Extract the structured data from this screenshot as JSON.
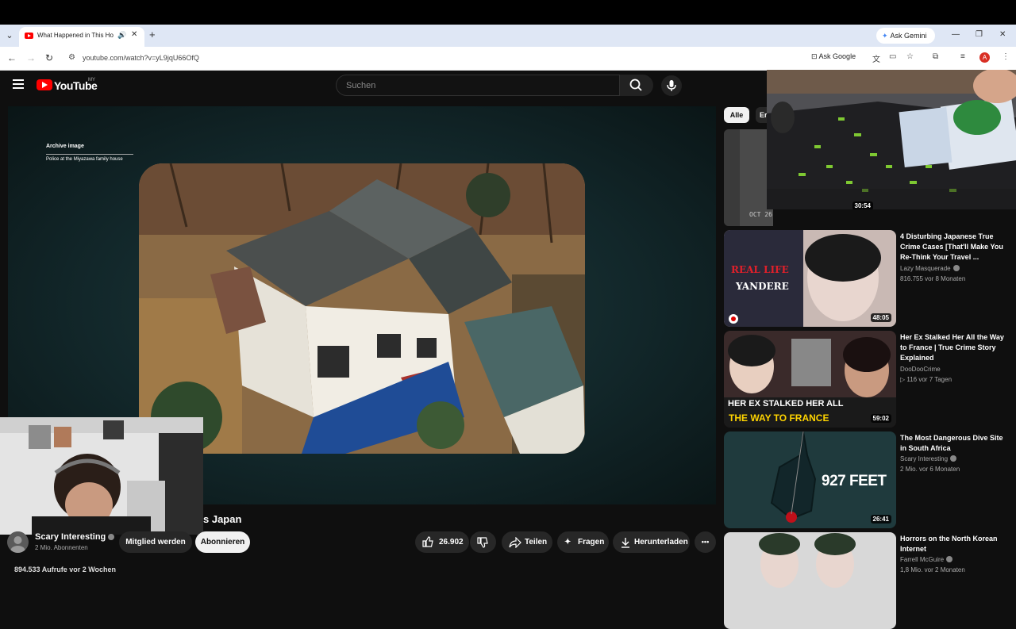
{
  "browser": {
    "tab_title": "What Happened in This Ho",
    "new_tab_label": "+",
    "gemini_label": "Ask Gemini",
    "url": "youtube.com/watch?v=yL9jqU66OfQ",
    "ask_google_label": "Ask Google",
    "profile_initial": "A"
  },
  "youtube": {
    "wordmark": "YouTube",
    "country": "MY",
    "search_placeholder": "Suchen"
  },
  "video": {
    "archive_label": "Archive image",
    "archive_sub": "Police at the Miyazawa family house",
    "title_fragment": "s Japan",
    "views_line": "894.533 Aufrufe  vor 2 Wochen"
  },
  "channel": {
    "name": "Scary Interesting",
    "subscribers": "2 Mio. Abonnenten",
    "join_label": "Mitglied werden",
    "subscribe_label": "Abonnieren"
  },
  "actions": {
    "likes": "26.902",
    "share_label": "Teilen",
    "ask_label": "Fragen",
    "download_label": "Herunterladen",
    "more_label": "•••"
  },
  "sidebar": {
    "chip_all": "Alle",
    "chip_next": "Er",
    "first_duration": "30:54",
    "first_date_stamp": "OCT 26 1985",
    "items": [
      {
        "title": "4 Disturbing Japanese True Crime Cases [That'll Make You Re-Think Your Travel ...",
        "channel": "Lazy Masquerade",
        "meta": "816.755  vor 8 Monaten",
        "duration": "48:05",
        "thumb_text_1": "REAL LIFE",
        "thumb_text_2": "YANDERE"
      },
      {
        "title": "Her Ex Stalked Her All the Way to France | True Crime Story Explained",
        "channel": "DooDooCrime",
        "meta": "116  vor 7 Tagen",
        "duration": "59:02",
        "thumb_text_1": "HER EX STALKED HER ALL",
        "thumb_text_2": "THE WAY TO FRANCE"
      },
      {
        "title": "The Most Dangerous Dive Site in South Africa",
        "channel": "Scary Interesting",
        "meta": "2 Mio.  vor 6 Monaten",
        "duration": "26:41",
        "thumb_text_1": "927 FEET"
      },
      {
        "title": "Horrors on the North Korean Internet",
        "channel": "Farrell McGuire",
        "meta": "1,8 Mio.  vor 2 Monaten"
      }
    ]
  },
  "colors": {
    "yt_red": "#ff0000",
    "background": "#0f0f0f",
    "tab_strip": "#dfe7f5"
  }
}
